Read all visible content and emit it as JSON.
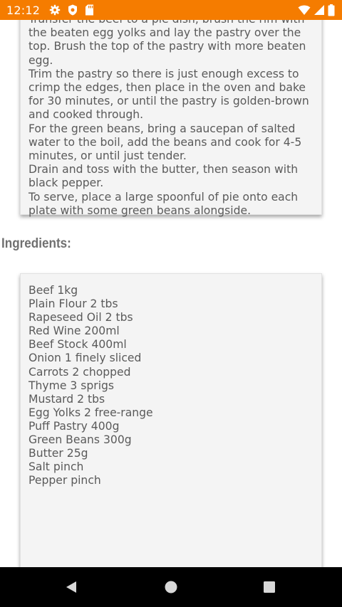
{
  "status_bar": {
    "time": "12:12",
    "background_color": "#f57c00",
    "icons": [
      "gear-icon",
      "shield-icon",
      "sd-card-icon",
      "wifi-icon",
      "signal-icon",
      "battery-icon"
    ]
  },
  "method": {
    "paragraphs": [
      "Transfer the beef to a pie dish, brush the rim with the beaten egg yolks and lay the pastry over the top. Brush the top of the pastry with more beaten egg.",
      "Trim the pastry so there is just enough excess to crimp the edges, then place in the oven and bake for 30 minutes, or until the pastry is golden-brown and cooked through.",
      "For the green beans, bring a saucepan of salted water to the boil, add the beans and cook for 4-5 minutes, or until just tender.",
      "Drain and toss with the butter, then season with black pepper.",
      "To serve, place a large spoonful of pie onto each plate with some green beans alongside."
    ]
  },
  "ingredients": {
    "heading": "Ingredients:",
    "items": [
      "Beef 1kg",
      "Plain Flour 2 tbs",
      "Rapeseed Oil 2 tbs",
      "Red Wine 200ml",
      "Beef Stock 400ml",
      "Onion 1 finely sliced",
      "Carrots 2 chopped",
      "Thyme 3 sprigs",
      "Mustard 2 tbs",
      "Egg Yolks 2 free-range",
      "Puff Pastry 400g",
      "Green Beans 300g",
      "Butter 25g",
      "Salt pinch",
      "Pepper pinch"
    ]
  },
  "nav_bar": {
    "buttons": [
      "back-icon",
      "home-icon",
      "recents-icon"
    ]
  }
}
